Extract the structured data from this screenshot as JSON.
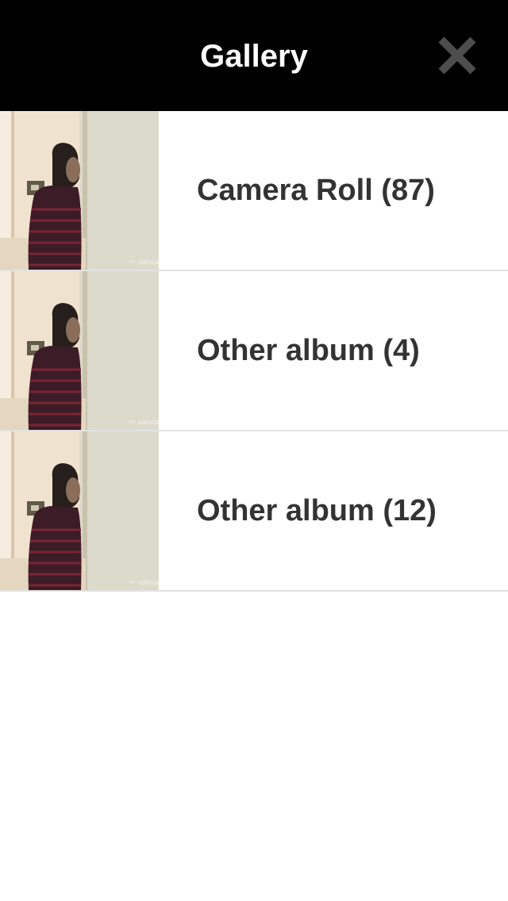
{
  "header": {
    "title": "Gallery",
    "close_icon": "close-icon"
  },
  "colors": {
    "nav_background": "#000000",
    "title_text": "#ffffff",
    "close_icon": "#4d4d4d",
    "album_text": "#333333",
    "separator": "#e2e2e2"
  },
  "albums": [
    {
      "label": "Camera Roll (87)",
      "thumbnail": "photo-thumbnail"
    },
    {
      "label": "Other album (4)",
      "thumbnail": "photo-thumbnail"
    },
    {
      "label": "Other album (12)",
      "thumbnail": "photo-thumbnail"
    }
  ]
}
